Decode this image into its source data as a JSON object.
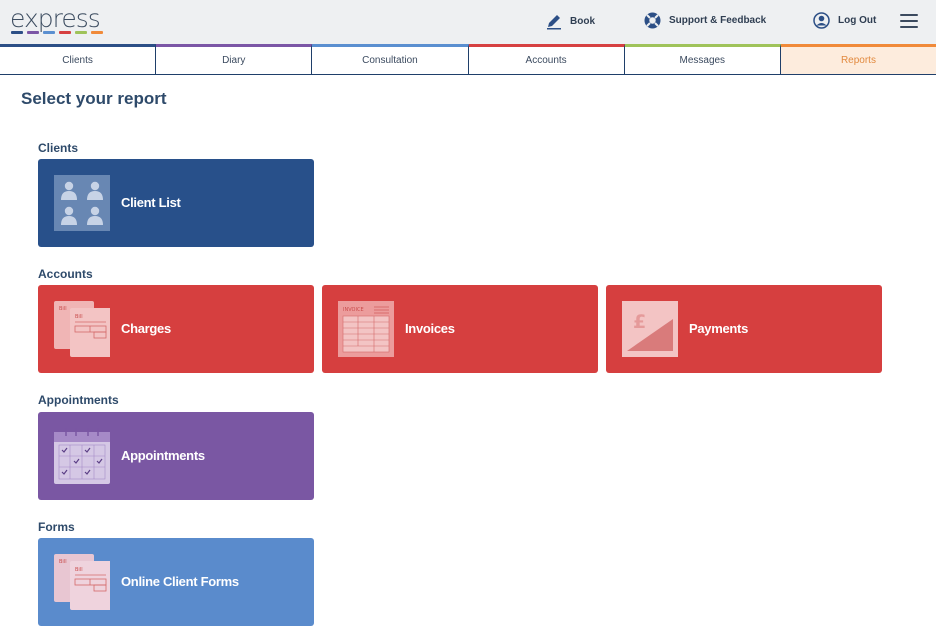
{
  "header": {
    "logo_text": "express",
    "logo_colors": [
      "#2c4f86",
      "#7b56a6",
      "#5a8fd0",
      "#d64041",
      "#9fc35a",
      "#f08a3a"
    ],
    "links": {
      "book": "Book",
      "support": "Support & Feedback",
      "logout": "Log Out"
    }
  },
  "tabs": [
    {
      "label": "Clients",
      "color": "#2c4f86"
    },
    {
      "label": "Diary",
      "color": "#7b56a6"
    },
    {
      "label": "Consultation",
      "color": "#5a8fd0"
    },
    {
      "label": "Accounts",
      "color": "#d64041"
    },
    {
      "label": "Messages",
      "color": "#9fc35a"
    },
    {
      "label": "Reports",
      "color": "#f08a3a",
      "active": true
    }
  ],
  "main": {
    "title": "Select your report",
    "sections": {
      "clients": {
        "label": "Clients",
        "cards": [
          {
            "label": "Client List",
            "color": "#28508a",
            "icon": "clients-icon"
          }
        ]
      },
      "accounts": {
        "label": "Accounts",
        "cards": [
          {
            "label": "Charges",
            "color": "#d63f3f",
            "icon": "bills-icon"
          },
          {
            "label": "Invoices",
            "color": "#d63f3f",
            "icon": "invoice-icon"
          },
          {
            "label": "Payments",
            "color": "#d63f3f",
            "icon": "pound-icon"
          }
        ]
      },
      "appointments": {
        "label": "Appointments",
        "cards": [
          {
            "label": "Appointments",
            "color": "#7a57a3",
            "icon": "calendar-icon"
          }
        ]
      },
      "forms": {
        "label": "Forms",
        "cards": [
          {
            "label": "Online Client Forms",
            "color": "#5a8bcc",
            "icon": "bills-icon"
          }
        ]
      }
    },
    "icon_text": {
      "bill": "Bill",
      "invoice": "INVOICE",
      "pound": "£"
    }
  }
}
